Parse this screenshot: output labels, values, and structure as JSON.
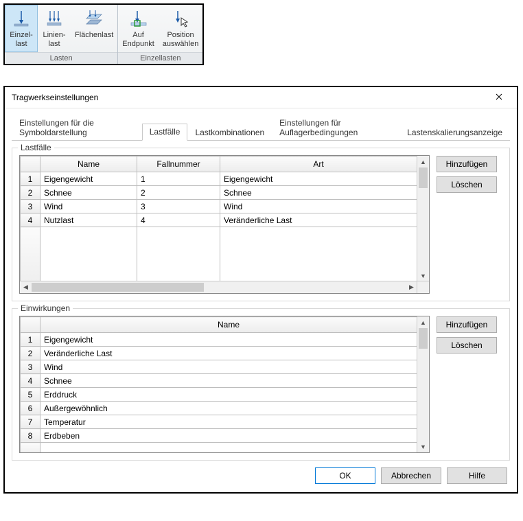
{
  "ribbon": {
    "groups": [
      {
        "title": "Lasten",
        "items": [
          {
            "name": "btn-einzellast",
            "label": "Einzel-\nlast",
            "active": true
          },
          {
            "name": "btn-linienlast",
            "label": "Linien-\nlast"
          },
          {
            "name": "btn-flaechenlast",
            "label": "Flächenlast"
          }
        ]
      },
      {
        "title": "Einzellasten",
        "items": [
          {
            "name": "btn-auf-endpunkt",
            "label": "Auf\nEndpunkt"
          },
          {
            "name": "btn-position-auswaehlen",
            "label": "Position\nauswählen"
          }
        ]
      }
    ]
  },
  "dialog": {
    "title": "Tragwerkseinstellungen",
    "tabs": [
      "Einstellungen für die Symboldarstellung",
      "Lastfälle",
      "Lastkombinationen",
      "Einstellungen für Auflagerbedingungen",
      "Lastenskalierungsanzeige"
    ],
    "activeTab": 1,
    "group1": {
      "legend": "Lastfälle",
      "headers": {
        "name": "Name",
        "num": "Fallnummer",
        "art": "Art"
      },
      "rows": [
        {
          "n": "1",
          "name": "Eigengewicht",
          "num": "1",
          "art": "Eigengewicht"
        },
        {
          "n": "2",
          "name": "Schnee",
          "num": "2",
          "art": "Schnee"
        },
        {
          "n": "3",
          "name": "Wind",
          "num": "3",
          "art": "Wind"
        },
        {
          "n": "4",
          "name": "Nutzlast",
          "num": "4",
          "art": "Veränderliche Last"
        }
      ],
      "add": "Hinzufügen",
      "del": "Löschen"
    },
    "group2": {
      "legend": "Einwirkungen",
      "header": "Name",
      "rows": [
        {
          "n": "1",
          "name": "Eigengewicht"
        },
        {
          "n": "2",
          "name": "Veränderliche Last"
        },
        {
          "n": "3",
          "name": "Wind"
        },
        {
          "n": "4",
          "name": "Schnee"
        },
        {
          "n": "5",
          "name": "Erddruck"
        },
        {
          "n": "6",
          "name": "Außergewöhnlich"
        },
        {
          "n": "7",
          "name": "Temperatur"
        },
        {
          "n": "8",
          "name": "Erdbeben"
        }
      ],
      "add": "Hinzufügen",
      "del": "Löschen"
    },
    "buttons": {
      "ok": "OK",
      "cancel": "Abbrechen",
      "help": "Hilfe"
    }
  }
}
